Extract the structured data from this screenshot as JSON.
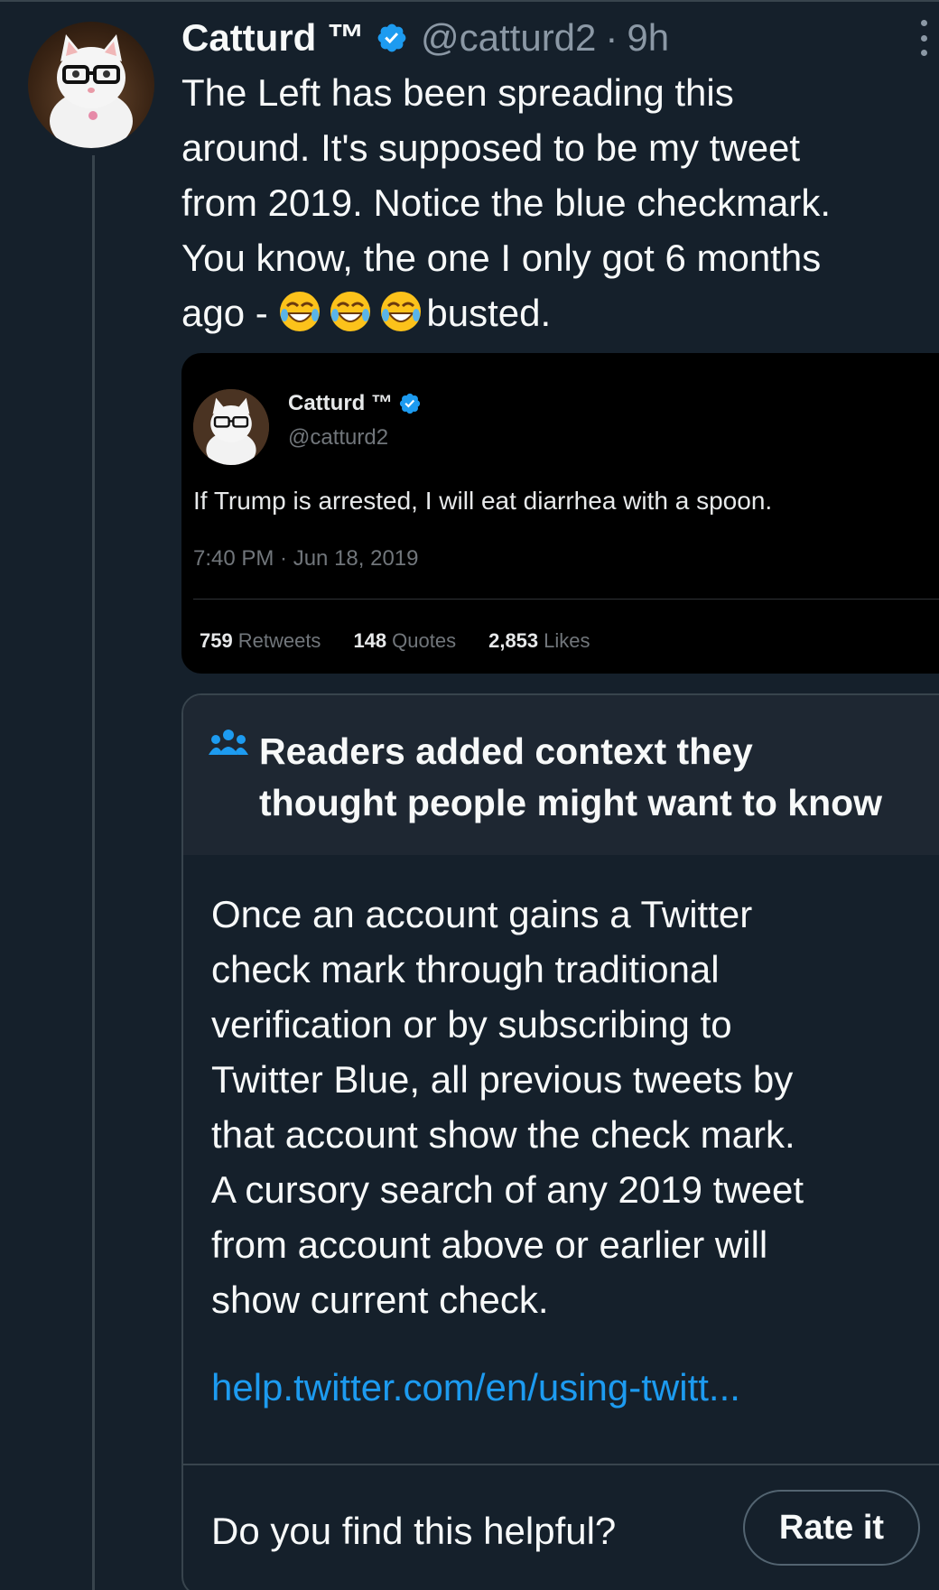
{
  "tweet": {
    "display_name": "Catturd ™",
    "handle": "@catturd2",
    "separator": "·",
    "time": "9h",
    "text_lines": [
      "The Left has been spreading this",
      "around. It's supposed to be my tweet",
      "from 2019. Notice the blue checkmark.",
      "You know, the one I only got 6 months"
    ],
    "text_last_prefix": "ago - ",
    "text_last_suffix": "busted."
  },
  "embedded_tweet": {
    "display_name": "Catturd ™",
    "handle": "@catturd2",
    "text": "If Trump is arrested, I will eat diarrhea with a spoon.",
    "timestamp": "7:40 PM · Jun 18, 2019",
    "stats": [
      {
        "value": "759",
        "label": "Retweets"
      },
      {
        "value": "148",
        "label": "Quotes"
      },
      {
        "value": "2,853",
        "label": "Likes"
      }
    ]
  },
  "community_note": {
    "title_lines": [
      "Readers added context they",
      "thought people might want to know"
    ],
    "body_lines": [
      "Once an account gains a Twitter",
      "check mark through traditional",
      "verification or by subscribing to",
      "Twitter Blue, all previous tweets by",
      "that account show the check mark.",
      "A cursory search of any 2019 tweet",
      "from account above or earlier will",
      "show current check."
    ],
    "link": "help.twitter.com/en/using-twitt...",
    "helpful_question": "Do you find this helpful?",
    "rate_button": "Rate it"
  },
  "colors": {
    "background": "#15202b",
    "accent": "#1d9bf0",
    "secondary_text": "#8b98a5"
  }
}
